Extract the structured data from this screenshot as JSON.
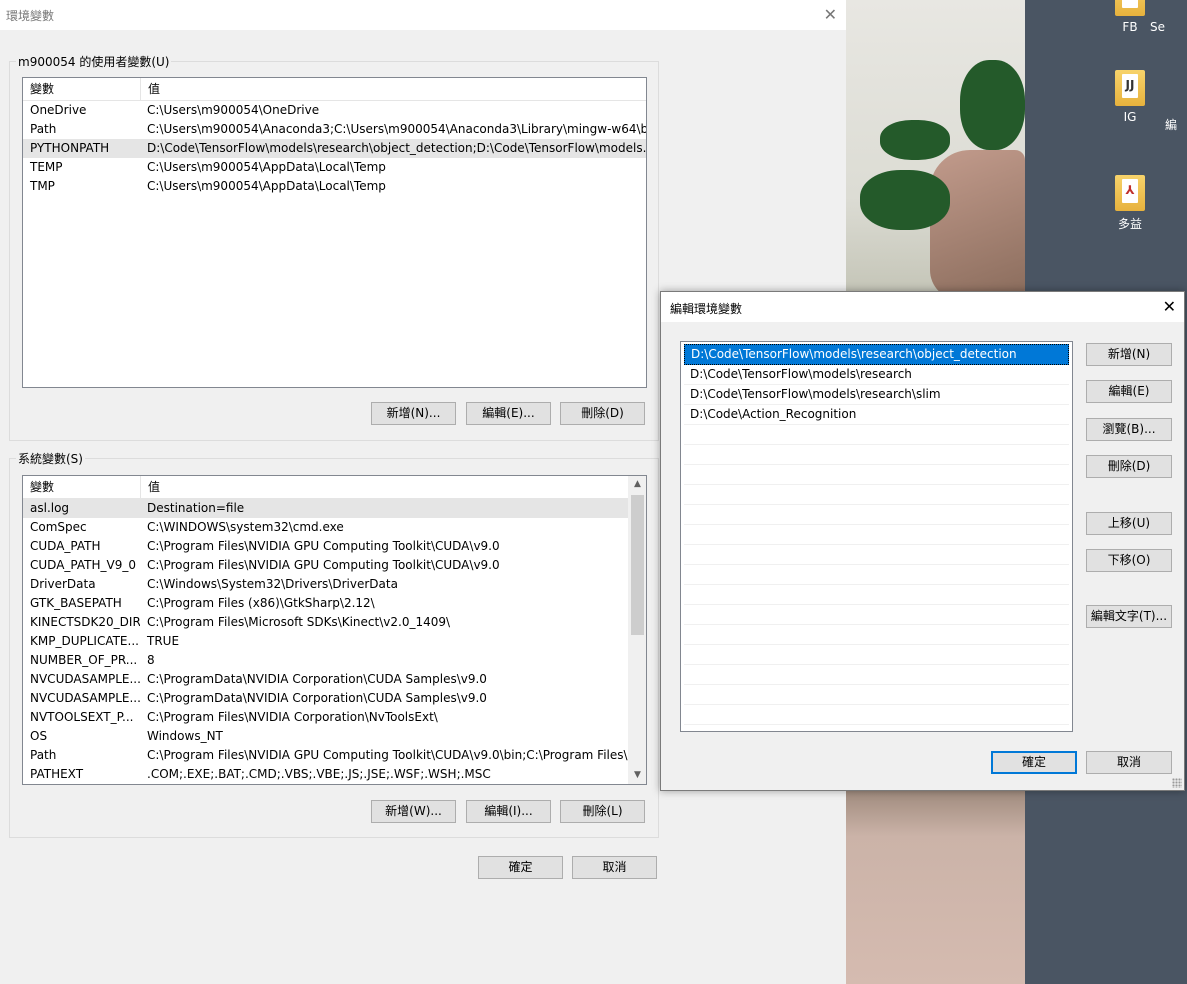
{
  "main_window": {
    "title": "環境變數",
    "user_group_label": "m900054 的使用者變數(U)",
    "system_group_label": "系統變數(S)",
    "col_variable": "變數",
    "col_value": "值",
    "user_vars": [
      {
        "name": "OneDrive",
        "value": "C:\\Users\\m900054\\OneDrive"
      },
      {
        "name": "Path",
        "value": "C:\\Users\\m900054\\Anaconda3;C:\\Users\\m900054\\Anaconda3\\Library\\mingw-w64\\bi..."
      },
      {
        "name": "PYTHONPATH",
        "value": "D:\\Code\\TensorFlow\\models\\research\\object_detection;D:\\Code\\TensorFlow\\models..."
      },
      {
        "name": "TEMP",
        "value": "C:\\Users\\m900054\\AppData\\Local\\Temp"
      },
      {
        "name": "TMP",
        "value": "C:\\Users\\m900054\\AppData\\Local\\Temp"
      }
    ],
    "user_buttons": {
      "new": "新增(N)...",
      "edit": "編輯(E)...",
      "delete": "刪除(D)"
    },
    "system_vars": [
      {
        "name": "asl.log",
        "value": "Destination=file"
      },
      {
        "name": "ComSpec",
        "value": "C:\\WINDOWS\\system32\\cmd.exe"
      },
      {
        "name": "CUDA_PATH",
        "value": "C:\\Program Files\\NVIDIA GPU Computing Toolkit\\CUDA\\v9.0"
      },
      {
        "name": "CUDA_PATH_V9_0",
        "value": "C:\\Program Files\\NVIDIA GPU Computing Toolkit\\CUDA\\v9.0"
      },
      {
        "name": "DriverData",
        "value": "C:\\Windows\\System32\\Drivers\\DriverData"
      },
      {
        "name": "GTK_BASEPATH",
        "value": "C:\\Program Files (x86)\\GtkSharp\\2.12\\"
      },
      {
        "name": "KINECTSDK20_DIR",
        "value": "C:\\Program Files\\Microsoft SDKs\\Kinect\\v2.0_1409\\"
      },
      {
        "name": "KMP_DUPLICATE...",
        "value": "TRUE"
      },
      {
        "name": "NUMBER_OF_PR...",
        "value": "8"
      },
      {
        "name": "NVCUDASAMPLE...",
        "value": "C:\\ProgramData\\NVIDIA Corporation\\CUDA Samples\\v9.0"
      },
      {
        "name": "NVCUDASAMPLE...",
        "value": "C:\\ProgramData\\NVIDIA Corporation\\CUDA Samples\\v9.0"
      },
      {
        "name": "NVTOOLSEXT_P...",
        "value": "C:\\Program Files\\NVIDIA Corporation\\NvToolsExt\\"
      },
      {
        "name": "OS",
        "value": "Windows_NT"
      },
      {
        "name": "Path",
        "value": "C:\\Program Files\\NVIDIA GPU Computing Toolkit\\CUDA\\v9.0\\bin;C:\\Program Files\\..."
      },
      {
        "name": "PATHEXT",
        "value": ".COM;.EXE;.BAT;.CMD;.VBS;.VBE;.JS;.JSE;.WSF;.WSH;.MSC"
      }
    ],
    "system_buttons": {
      "new": "新增(W)...",
      "edit": "編輯(I)...",
      "delete": "刪除(L)"
    },
    "ok": "確定",
    "cancel": "取消"
  },
  "edit_dialog": {
    "title": "編輯環境變數",
    "paths": [
      "D:\\Code\\TensorFlow\\models\\research\\object_detection",
      "D:\\Code\\TensorFlow\\models\\research",
      "D:\\Code\\TensorFlow\\models\\research\\slim",
      "D:\\Code\\Action_Recognition"
    ],
    "buttons": {
      "new": "新增(N)",
      "edit": "編輯(E)",
      "browse": "瀏覽(B)...",
      "delete": "刪除(D)",
      "move_up": "上移(U)",
      "move_down": "下移(O)",
      "edit_text": "編輯文字(T)..."
    },
    "ok": "確定",
    "cancel": "取消"
  },
  "desktop": {
    "icons": [
      {
        "label": "FB",
        "icon": "folder-icon"
      },
      {
        "label": "Se",
        "icon": "folder-icon"
      },
      {
        "label": "IG",
        "icon": "folder-icon"
      },
      {
        "label": "編",
        "icon": "folder-icon"
      },
      {
        "label": "多益",
        "icon": "pdf-folder-icon"
      }
    ]
  }
}
